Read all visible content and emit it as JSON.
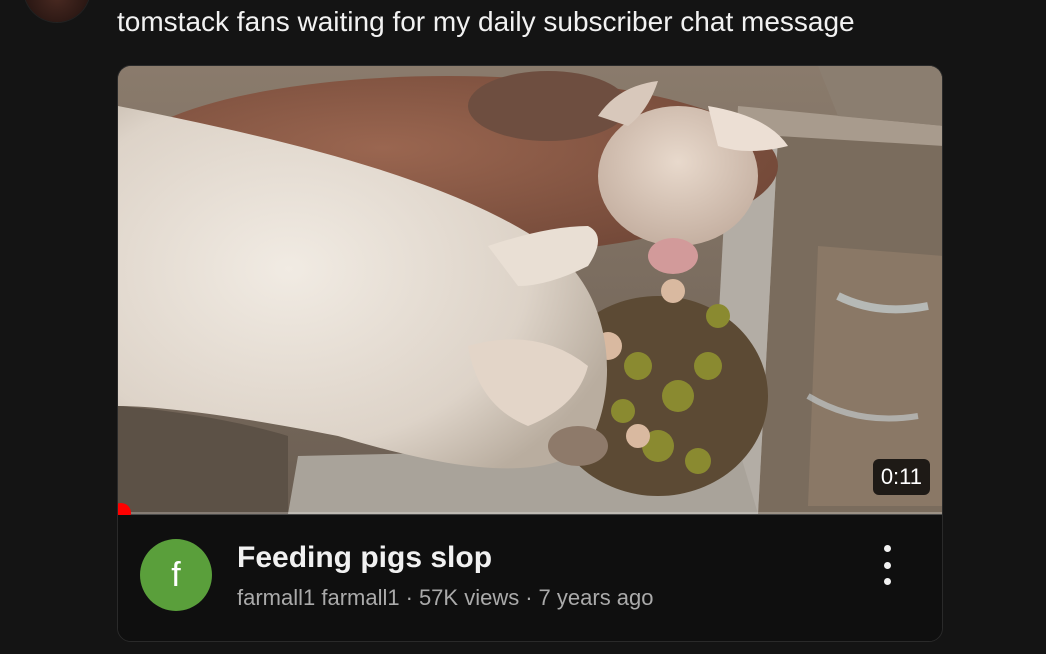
{
  "post": {
    "text": "tomstack fans waiting for my daily subscriber chat message"
  },
  "video": {
    "thumbnail": "pigs-eating-from-trough-image",
    "duration": "0:11",
    "progress_fraction": 0.0,
    "title": "Feeding pigs slop",
    "channel_initial": "f",
    "channel_avatar_color": "#5a9f3b",
    "channel": "farmall1 farmall1",
    "separator": "·",
    "views": "57K views",
    "age": "7 years ago",
    "menu_icon": "more-vert-icon"
  },
  "colors": {
    "background": "#141414",
    "card": "#0f0f0f",
    "progress": "#ff0000",
    "meta_text": "#aaaaaa"
  }
}
